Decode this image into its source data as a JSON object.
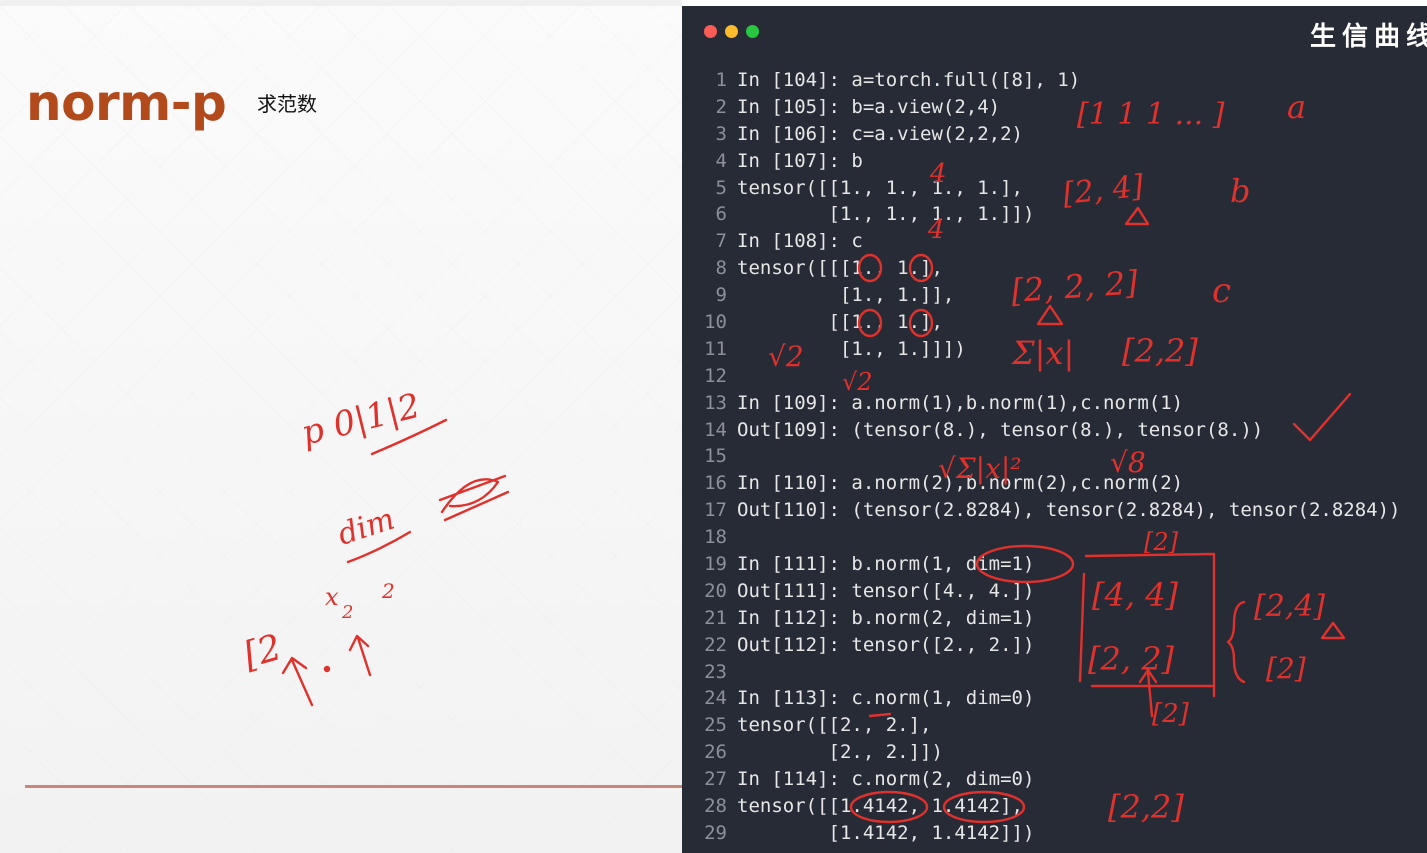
{
  "slide": {
    "title": "norm-p",
    "subtitle": "求范数",
    "handwriting": {
      "p_values": "p 0|1|2",
      "dim_word": "dim",
      "shape": "[2",
      "x2": "x",
      "sub2": "2",
      "sup2": "2"
    }
  },
  "terminal": {
    "watermark": "生信曲线",
    "code_lines": [
      {
        "n": "1",
        "text": "In [104]: a=torch.full([8], 1)"
      },
      {
        "n": "2",
        "text": "In [105]: b=a.view(2,4)"
      },
      {
        "n": "3",
        "text": "In [106]: c=a.view(2,2,2)"
      },
      {
        "n": "4",
        "text": "In [107]: b"
      },
      {
        "n": "5",
        "text": "tensor([[1., 1., 1., 1.],"
      },
      {
        "n": "6",
        "text": "        [1., 1., 1., 1.]])"
      },
      {
        "n": "7",
        "text": "In [108]: c"
      },
      {
        "n": "8",
        "text": "tensor([[[1., 1.],"
      },
      {
        "n": "9",
        "text": "         [1., 1.]],"
      },
      {
        "n": "10",
        "text": "        [[1., 1.],"
      },
      {
        "n": "11",
        "text": "         [1., 1.]]])"
      },
      {
        "n": "12",
        "text": ""
      },
      {
        "n": "13",
        "text": "In [109]: a.norm(1),b.norm(1),c.norm(1)"
      },
      {
        "n": "14",
        "text": "Out[109]: (tensor(8.), tensor(8.), tensor(8.))"
      },
      {
        "n": "15",
        "text": ""
      },
      {
        "n": "16",
        "text": "In [110]: a.norm(2),b.norm(2),c.norm(2)"
      },
      {
        "n": "17",
        "text": "Out[110]: (tensor(2.8284), tensor(2.8284), tensor(2.8284))"
      },
      {
        "n": "18",
        "text": ""
      },
      {
        "n": "19",
        "text": "In [111]: b.norm(1, dim=1)"
      },
      {
        "n": "20",
        "text": "Out[111]: tensor([4., 4.])"
      },
      {
        "n": "21",
        "text": "In [112]: b.norm(2, dim=1)"
      },
      {
        "n": "22",
        "text": "Out[112]: tensor([2., 2.])"
      },
      {
        "n": "23",
        "text": ""
      },
      {
        "n": "24",
        "text": "In [113]: c.norm(1, dim=0)"
      },
      {
        "n": "25",
        "text": "tensor([[2., 2.],"
      },
      {
        "n": "26",
        "text": "        [2., 2.]])"
      },
      {
        "n": "27",
        "text": "In [114]: c.norm(2, dim=0)"
      },
      {
        "n": "28",
        "text": "tensor([[1.4142, 1.4142],"
      },
      {
        "n": "29",
        "text": "        [1.4142, 1.4142]])"
      }
    ],
    "annotations": {
      "a_vec": "[1 1 1 ... ]",
      "a": "a",
      "four_top": "4",
      "shape_b": "[2, 4]",
      "b": "b",
      "four_mid": "4",
      "shape_c": "[2, 2, 2]",
      "c": "c",
      "sum_abs": "Σ|x|",
      "shape_22": "[2,2]",
      "sqrt2_a": "√2",
      "sqrt2_b": "√2",
      "sum_sq": "√Σ|x|²",
      "sqrt8": "√8",
      "bracket2": "[2]",
      "bracket44": "[4, 4]",
      "bracket2x2": "[2, 2]",
      "shape_24_right": "[2,4]",
      "bracket2_right": "[2]",
      "bracket2_bottom": "[2]",
      "shape_22_bottom": "[2,2]"
    }
  }
}
